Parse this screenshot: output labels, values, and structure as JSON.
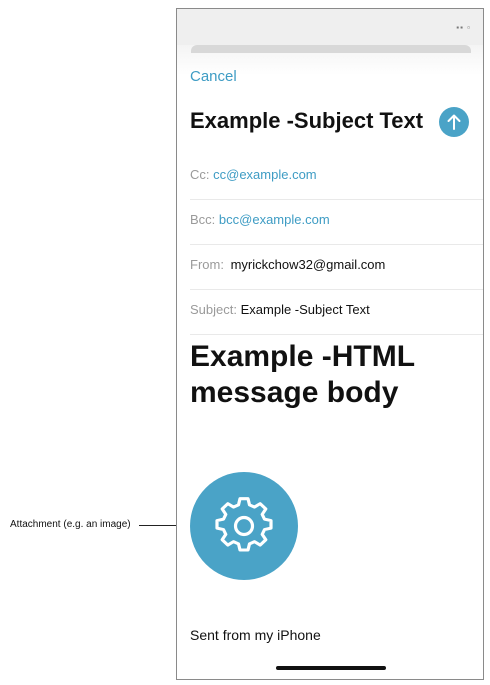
{
  "annotation": {
    "label": "Attachment (e.g. an image)"
  },
  "compose": {
    "cancel_label": "Cancel",
    "subject_title": "Example -Subject Text",
    "fields": {
      "cc": {
        "label": "Cc:",
        "value": "cc@example.com"
      },
      "bcc": {
        "label": "Bcc:",
        "value": "bcc@example.com"
      },
      "from": {
        "label": "From:",
        "value": "myrickchow32@gmail.com"
      },
      "subject": {
        "label": "Subject:",
        "value": "Example -Subject Text"
      }
    },
    "body": {
      "heading_line1": "Example -HTML",
      "heading_line2": "message body"
    },
    "signature": "Sent from my iPhone"
  },
  "icons": {
    "send": "arrow-up-icon",
    "attachment": "gear-icon"
  },
  "colors": {
    "accent": "#4aa3c7",
    "link": "#3e9cc4",
    "label_gray": "#9a9a9a"
  }
}
